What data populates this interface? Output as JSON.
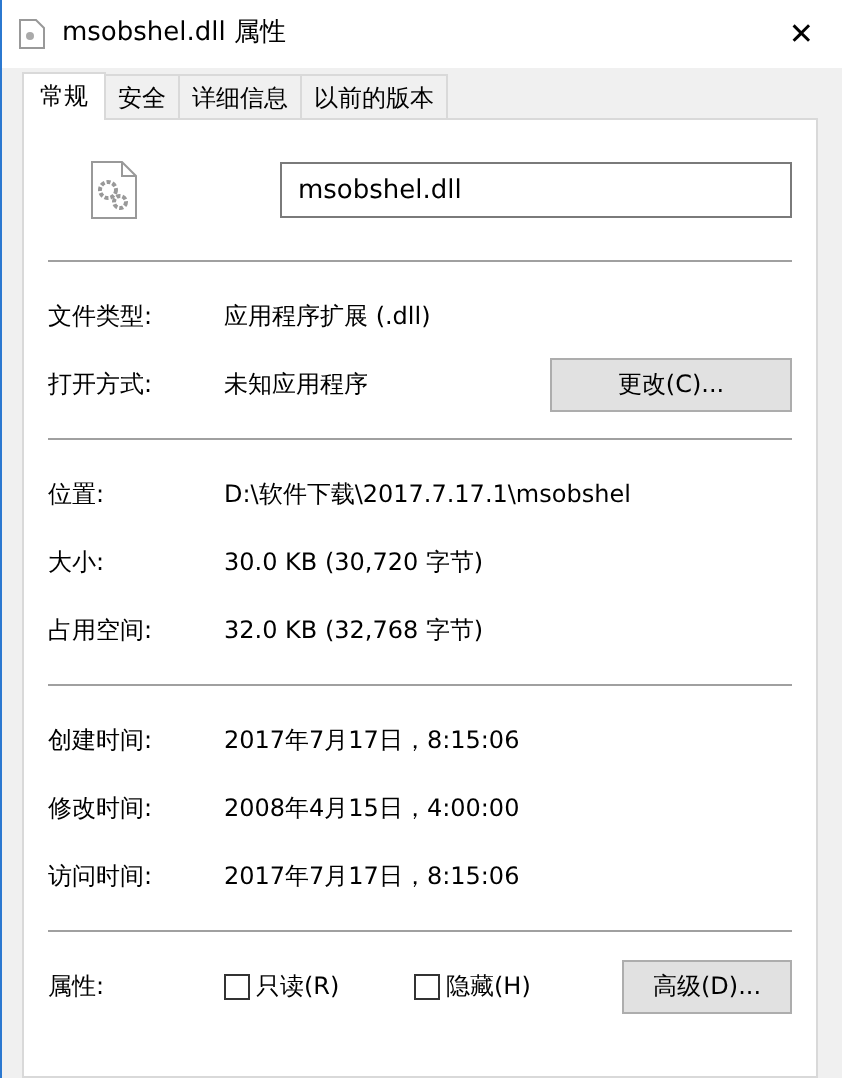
{
  "window": {
    "title": "msobshel.dll 属性",
    "close": "✕"
  },
  "tabs": [
    {
      "label": "常规",
      "selected": true
    },
    {
      "label": "安全",
      "selected": false
    },
    {
      "label": "详细信息",
      "selected": false
    },
    {
      "label": "以前的版本",
      "selected": false
    }
  ],
  "file_name": "msobshel.dll",
  "sections": [
    [
      {
        "label": "文件类型:",
        "value": "应用程序扩展 (.dll)"
      },
      {
        "label": "打开方式:",
        "value": "未知应用程序",
        "button": "更改(C)..."
      }
    ],
    [
      {
        "label": "位置:",
        "value": "D:\\软件下载\\2017.7.17.1\\msobshel"
      },
      {
        "label": "大小:",
        "value": "30.0 KB (30,720 字节)"
      },
      {
        "label": "占用空间:",
        "value": "32.0 KB (32,768 字节)"
      }
    ],
    [
      {
        "label": "创建时间:",
        "value": "2017年7月17日，8:15:06"
      },
      {
        "label": "修改时间:",
        "value": "2008年4月15日，4:00:00"
      },
      {
        "label": "访问时间:",
        "value": "2017年7月17日，8:15:06"
      }
    ]
  ],
  "attributes": {
    "label": "属性:",
    "checkboxes": [
      {
        "label": "只读(R)",
        "checked": false
      },
      {
        "label": "隐藏(H)",
        "checked": false
      }
    ],
    "button": "高级(D)..."
  }
}
